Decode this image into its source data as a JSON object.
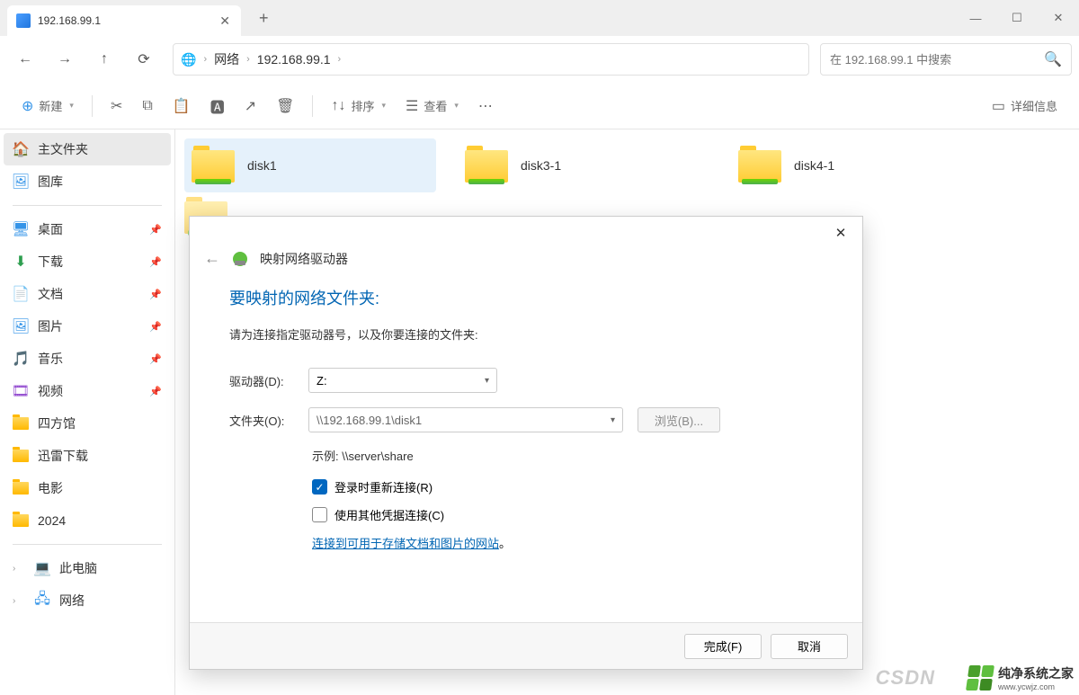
{
  "titlebar": {
    "tab_title": "192.168.99.1",
    "new_tab_title": "+",
    "minimize": "—",
    "maximize": "☐",
    "close": "✕"
  },
  "nav": {
    "back": "←",
    "forward": "→",
    "up": "↑",
    "refresh": "⟳"
  },
  "address": {
    "root": "网络",
    "host": "192.168.99.1"
  },
  "search": {
    "placeholder": "在 192.168.99.1 中搜索"
  },
  "toolbar": {
    "new_label": "新建",
    "sort_label": "排序",
    "view_label": "查看",
    "details_label": "详细信息"
  },
  "sidebar": {
    "home": "主文件夹",
    "gallery": "图库",
    "desktop": "桌面",
    "downloads": "下载",
    "documents": "文档",
    "pictures": "图片",
    "music": "音乐",
    "videos": "视频",
    "sifangguan": "四方馆",
    "xunlei": "迅雷下载",
    "movies": "电影",
    "year": "2024",
    "this_pc": "此电脑",
    "network": "网络"
  },
  "folders": [
    {
      "name": "disk1",
      "selected": true
    },
    {
      "name": "disk3-1",
      "selected": false
    },
    {
      "name": "disk4-1",
      "selected": false
    }
  ],
  "dialog": {
    "title": "映射网络驱动器",
    "heading": "要映射的网络文件夹:",
    "subtitle": "请为连接指定驱动器号，以及你要连接的文件夹:",
    "drive_label": "驱动器(D):",
    "drive_value": "Z:",
    "folder_label": "文件夹(O):",
    "folder_value": "\\\\192.168.99.1\\disk1",
    "browse": "浏览(B)...",
    "example": "示例: \\\\server\\share",
    "reconnect": "登录时重新连接(R)",
    "other_creds": "使用其他凭据连接(C)",
    "link": "连接到可用于存储文档和图片的网站",
    "link_suffix": "。",
    "finish": "完成(F)",
    "cancel": "取消"
  },
  "watermark": {
    "csdn": "CSDN",
    "brand": "纯净系统之家",
    "url": "www.ycwjz.com"
  }
}
